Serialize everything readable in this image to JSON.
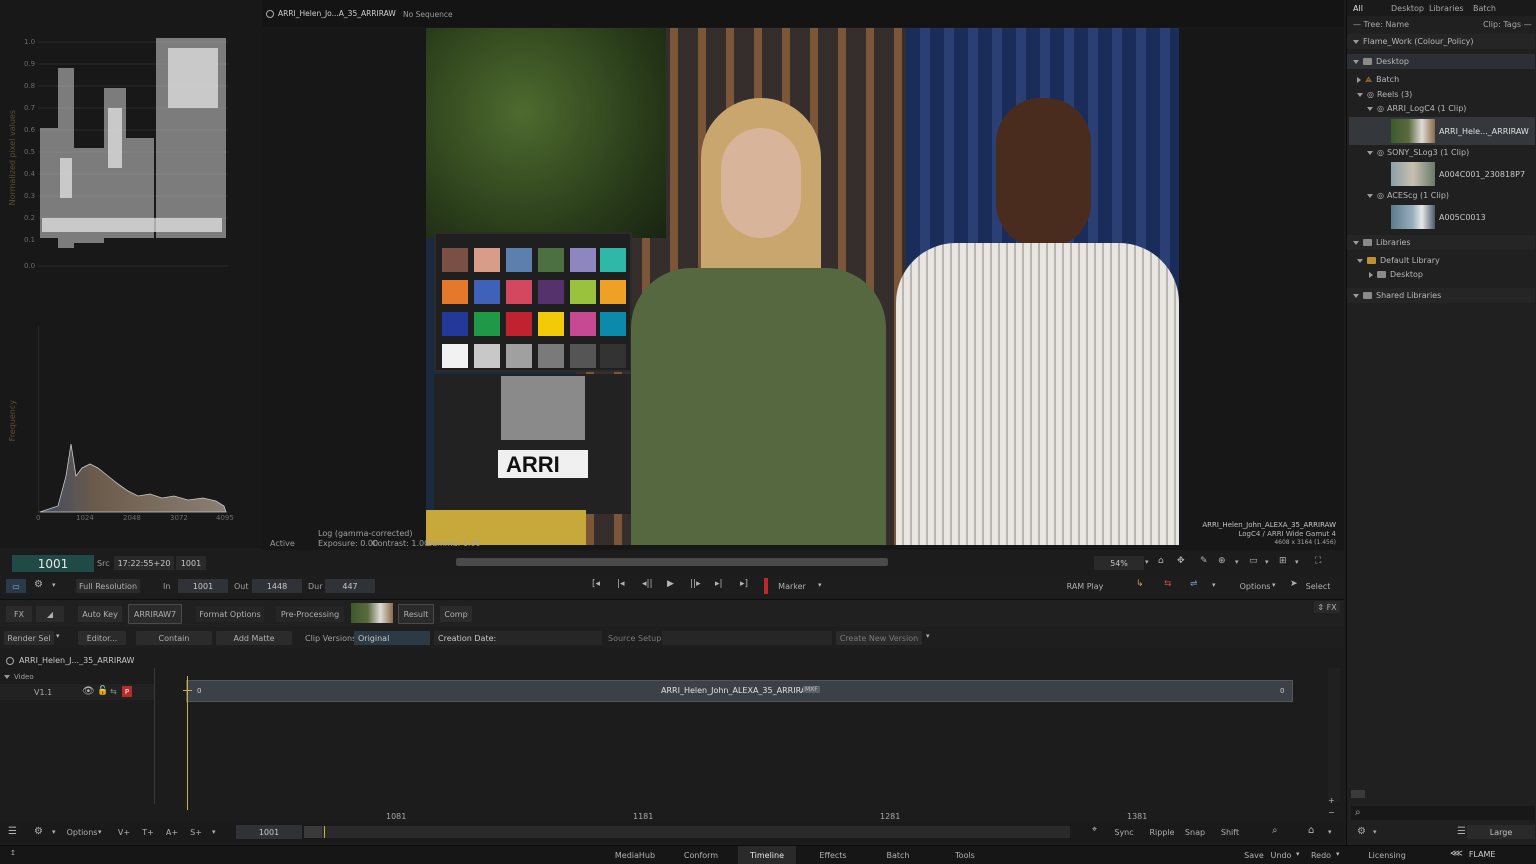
{
  "scopes": {
    "waveform_ylabel": "Normalized pixel values",
    "waveform_ticks": [
      "1.0",
      "0.9",
      "0.8",
      "0.7",
      "0.6",
      "0.5",
      "0.4",
      "0.3",
      "0.2",
      "0.1",
      "0.0"
    ],
    "histogram_ylabel": "Frequency",
    "histogram_ticks": [
      "0",
      "1024",
      "2048",
      "3072",
      "4095"
    ]
  },
  "viewer": {
    "clip_tab": "ARRI_Helen_Jo...A_35_ARRIRAW",
    "sequence_tab": "No Sequence",
    "status_active": "Active",
    "curve_mode": "Log (gamma-corrected)",
    "exposure": "Exposure: 0.00",
    "contrast": "Contrast: 1.00",
    "gamma": "Gamma: 1.00",
    "overlay_name": "ARRI_Helen_John_ALEXA_35_ARRIRAW",
    "overlay_color": "LogC4 / ARRI Wide Gamut 4",
    "overlay_res": "4608 x 3164 (1.456)"
  },
  "media_panel": {
    "tabs": [
      "All",
      "Desktop",
      "Libraries",
      "Batch"
    ],
    "tree_label": "— Tree: Name",
    "clip_label": "Clip: Tags —",
    "project": "Flame_Work (Colour_Policy)",
    "desktop": "Desktop",
    "batch": "Batch",
    "reels": "Reels (3)",
    "reel1": "ARRI_LogC4 (1 Clip)",
    "clip1": "ARRI_Hele..._ARRIRAW",
    "reel2": "SONY_SLog3 (1 Clip)",
    "clip2": "A004C001_230818P7",
    "reel3": "ACEScg (1 Clip)",
    "clip3": "A005C0013",
    "libraries": "Libraries",
    "default_library": "Default Library",
    "lib_desktop": "Desktop",
    "shared_libraries": "Shared Libraries",
    "size_label": "Large"
  },
  "timecode": {
    "frame": "1001",
    "src_label": "Src",
    "src_tc": "17:22:55+20",
    "src_frame": "1001",
    "zoom": "54%"
  },
  "transport": {
    "full_resolution": "Full Resolution",
    "in_label": "In",
    "in_value": "1001",
    "out_label": "Out",
    "out_value": "1448",
    "dur_label": "Dur",
    "dur_value": "447",
    "marker": "Marker",
    "ram_play": "RAM Play",
    "options": "Options",
    "select": "Select"
  },
  "fx_bar": {
    "fx": "FX",
    "auto_key": "Auto Key",
    "arriraw": "ARRIRAW7",
    "format_options": "Format Options",
    "pre_processing": "Pre-Processing",
    "result": "Result",
    "comp": "Comp",
    "fx_right": "⇕ FX"
  },
  "settings_bar": {
    "render_sel": "Render Sel",
    "editor": "Editor...",
    "contain": "Contain",
    "add_matte": "Add Matte",
    "clip_versions": "Clip Versions",
    "original": "Original",
    "creation_date": "Creation Date:",
    "source_setup": "Source Setup",
    "create_new_version": "Create New Version"
  },
  "timeline": {
    "clip_title": "ARRI_Helen_J..._35_ARRIRAW",
    "video_label": "Video",
    "track": "V1.1",
    "track_tag": "P",
    "segment_name": "ARRI_Helen_John_ALEXA_35_ARRIRAW",
    "segment_badge": "MXF",
    "segment_start": "0",
    "segment_end": "0",
    "ruler": [
      "1081",
      "1181",
      "1281",
      "1381"
    ]
  },
  "bottom_toolbar": {
    "options": "Options",
    "v_plus": "V+",
    "t_plus": "T+",
    "a_plus": "A+",
    "s_plus": "S+",
    "frame": "1001",
    "sync": "Sync",
    "ripple": "Ripple",
    "snap": "Snap",
    "shift": "Shift"
  },
  "bottom_tabs": {
    "mediahub": "MediaHub",
    "conform": "Conform",
    "timeline": "Timeline",
    "effects": "Effects",
    "batch": "Batch",
    "tools": "Tools",
    "save": "Save",
    "undo": "Undo",
    "redo": "Redo",
    "licensing": "Licensing",
    "flame": "FLAME"
  },
  "colors": {
    "accent_green": "#1f4a45",
    "track_red": "#b82b2b",
    "playhead": "#c9b43a"
  }
}
